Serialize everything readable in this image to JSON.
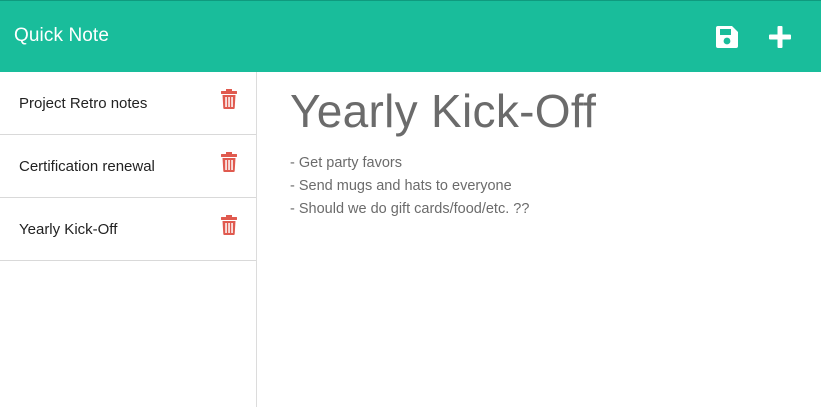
{
  "navbar": {
    "brand": "Quick Note",
    "save_icon": "save-icon",
    "new_icon": "plus-icon",
    "color": "#19bd9b"
  },
  "sidebar": {
    "notes": [
      {
        "title": "Project Retro notes",
        "delete_icon": "trash-icon"
      },
      {
        "title": "Certification renewal",
        "delete_icon": "trash-icon"
      },
      {
        "title": "Yearly Kick-Off",
        "delete_icon": "trash-icon"
      }
    ],
    "delete_color": "#e05a4f"
  },
  "main": {
    "title": "Yearly Kick-Off",
    "lines": [
      "- Get party favors",
      "- Send mugs and hats to everyone",
      "- Should we do gift cards/food/etc. ??"
    ]
  }
}
